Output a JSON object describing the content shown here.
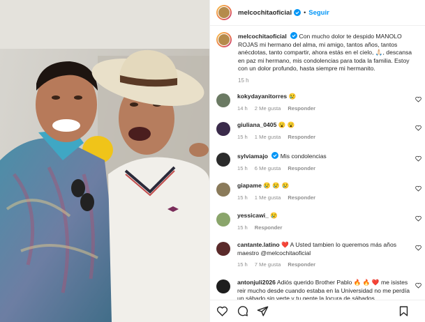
{
  "post": {
    "username": "melcochitaoficial",
    "follow_label": "Seguir",
    "dot": "•"
  },
  "caption": {
    "username": "melcochitaoficial",
    "text": "Con mucho dolor te despido MANOLO ROJAS mi hermano del alma, mi amigo, tantos años, tantos anécdotas, tanto compartir, ahora estás en el cielo, 🙏🏻, descansa en paz mi hermano, mis condolencias para toda la familia. Estoy con un dolor profundo, hasta siempre mi hermanito.",
    "time": "15 h"
  },
  "comments": [
    {
      "user": "kokydayanitorres",
      "verified": false,
      "text": "😢",
      "time": "14 h",
      "likes": "2 Me gusta",
      "reply": "Responder",
      "avatar_color": "#6b7a63"
    },
    {
      "user": "giuliana_0405",
      "verified": false,
      "text": "😮 😮",
      "time": "15 h",
      "likes": "1 Me gusta",
      "reply": "Responder",
      "avatar_color": "#3a2a4a"
    },
    {
      "user": "sylviamajo",
      "verified": true,
      "text": "Mis condolencias",
      "time": "15 h",
      "likes": "6 Me gusta",
      "reply": "Responder",
      "avatar_color": "#2b2b2b"
    },
    {
      "user": "giapame",
      "verified": false,
      "text": "😢 😢 😢",
      "time": "15 h",
      "likes": "1 Me gusta",
      "reply": "Responder",
      "avatar_color": "#8a7a5a"
    },
    {
      "user": "yessicawi_",
      "verified": false,
      "text": "😢",
      "time": "15 h",
      "likes": "",
      "reply": "Responder",
      "avatar_color": "#8aa56b"
    },
    {
      "user": "cantante.latino",
      "verified": false,
      "text": "❤️ A Usted tambien lo queremos más años maestro @melcochitaoficial",
      "time": "15 h",
      "likes": "7 Me gusta",
      "reply": "Responder",
      "avatar_color": "#5a2a2a"
    },
    {
      "user": "antonjuli2026",
      "verified": false,
      "text": "Adiós querido Brother Pablo 🔥 🔥 ❤️ me isistes reir mucho desde cuando estaba en la Universidad no me perdía un sábado sin verte y tu gente la locura de sábados",
      "time": "",
      "likes": "",
      "reply": "",
      "avatar_color": "#1e1e1e"
    }
  ],
  "colors": {
    "accent": "#0095f6",
    "muted": "#8e8e8e",
    "heart_red": "#ed4956"
  },
  "icons": [
    "verified-icon",
    "heart-icon",
    "comment-icon",
    "share-icon",
    "bookmark-icon"
  ]
}
